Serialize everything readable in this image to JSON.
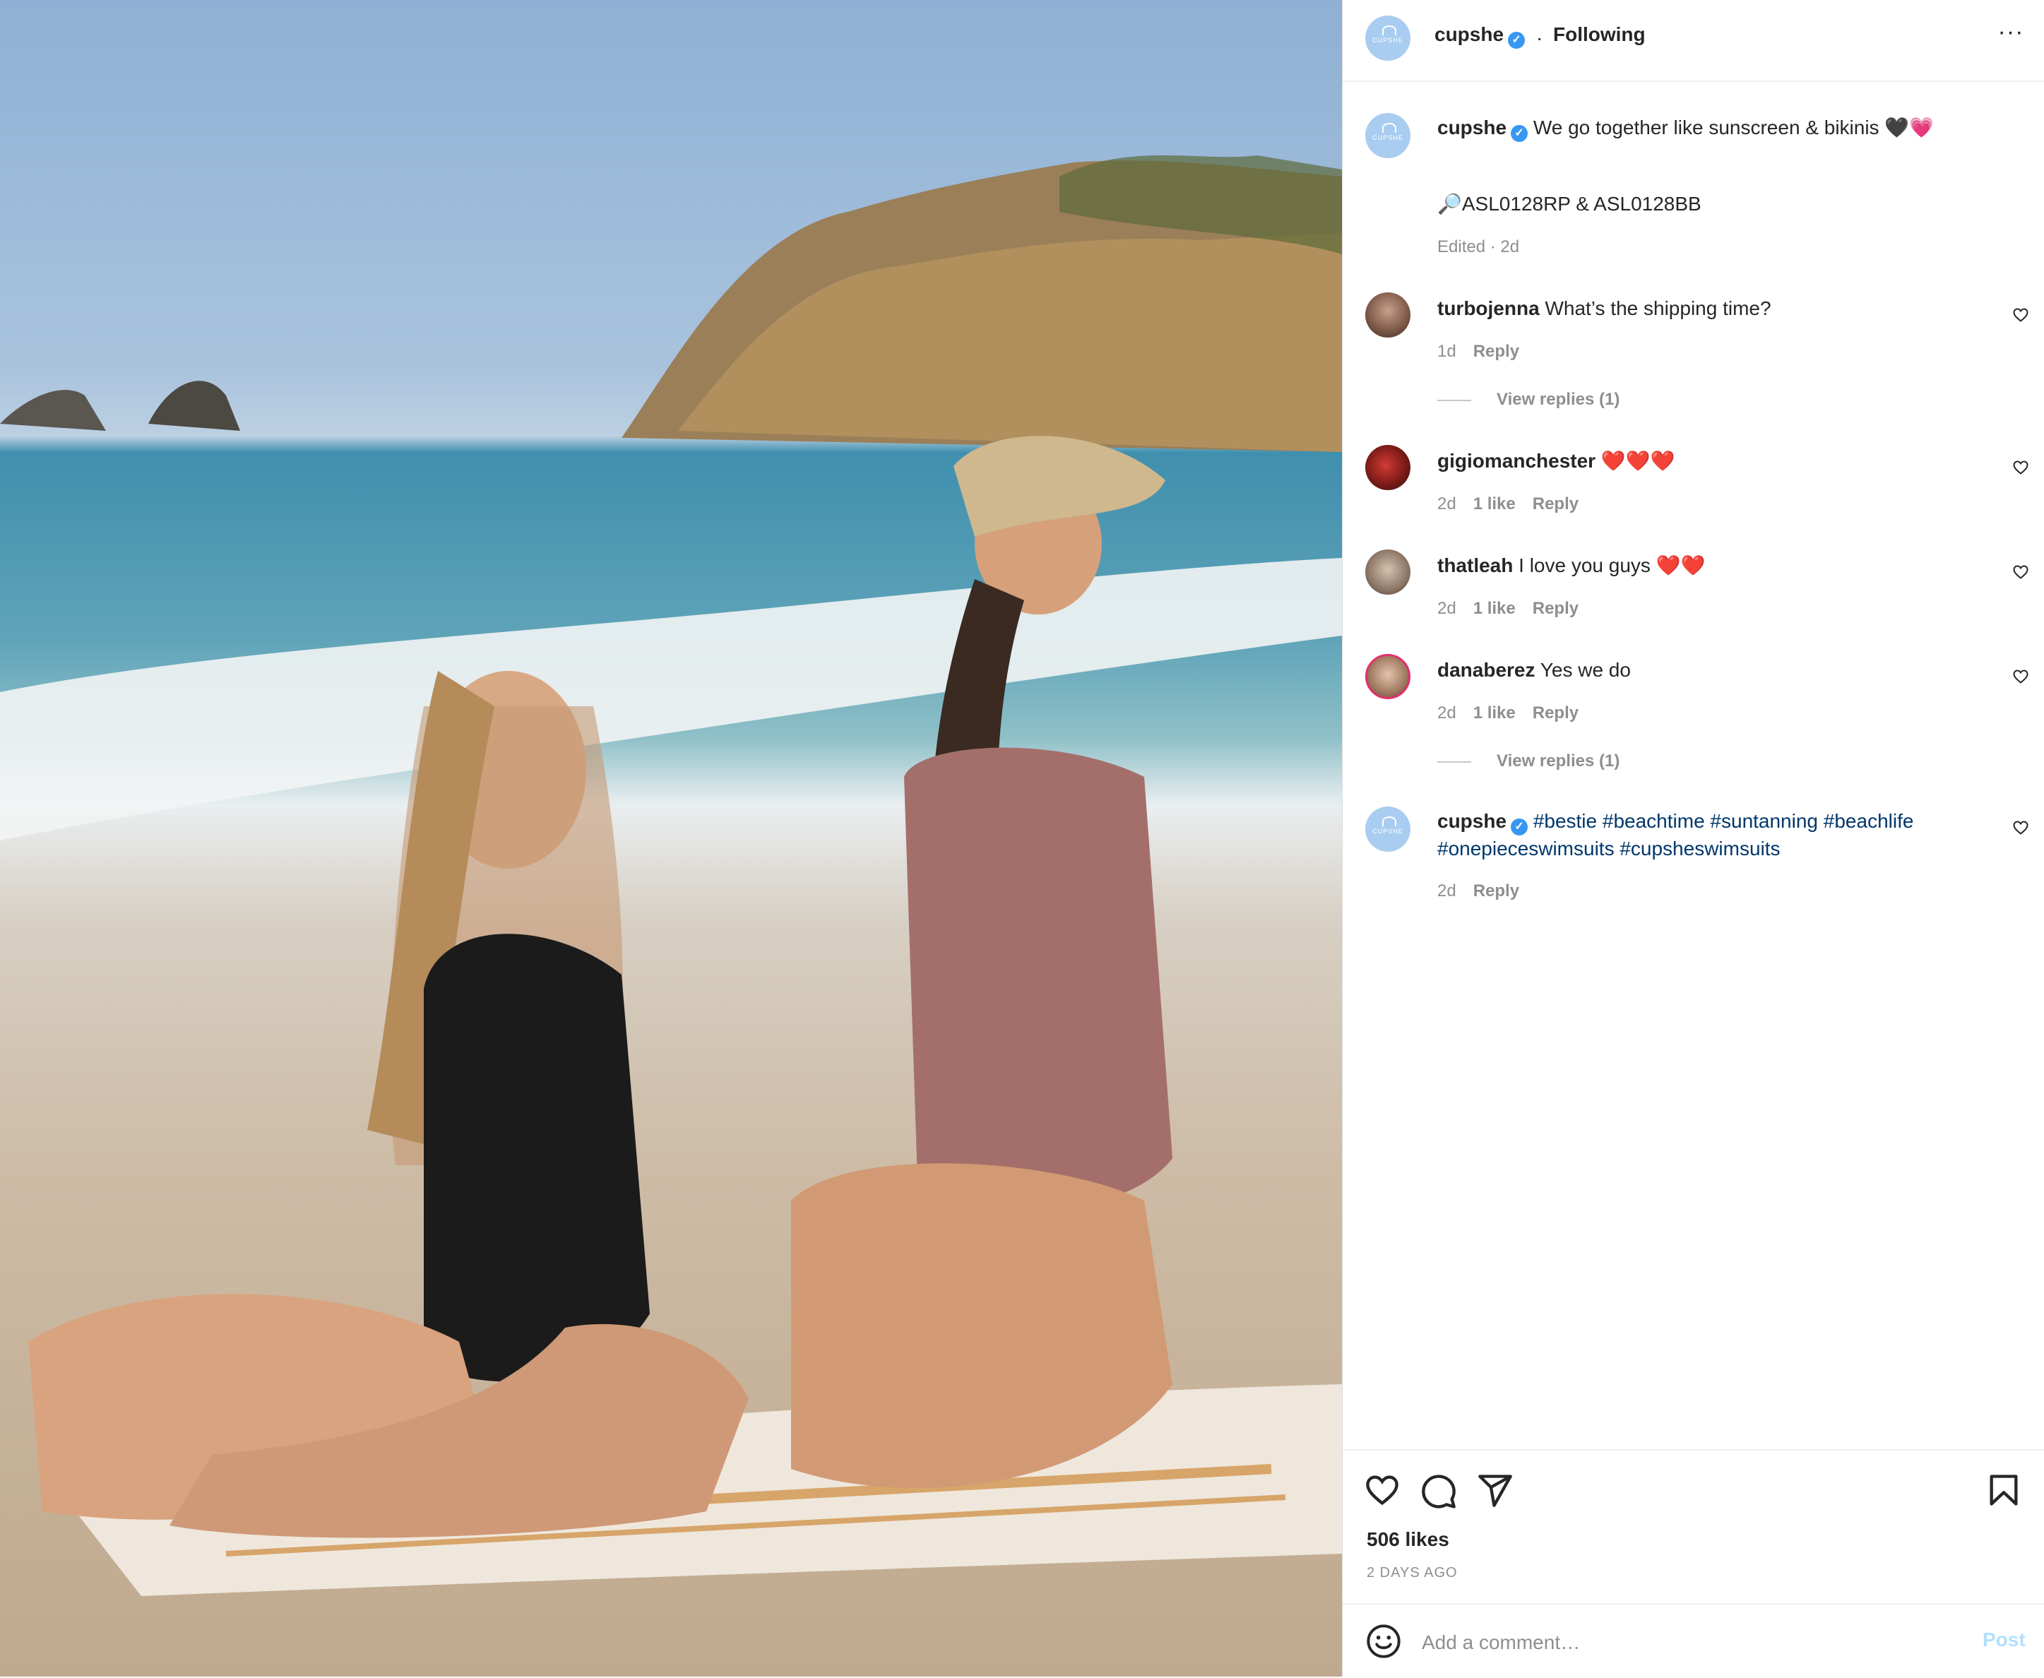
{
  "post": {
    "author": "cupshe",
    "author_verified": true,
    "follow_status": "Following",
    "image_description_icon": "photo"
  },
  "header": {
    "more_icon": "more-horizontal-icon"
  },
  "caption": {
    "username": "cupshe",
    "text": "We go together like sunscreen & bikinis 🖤💗",
    "product_codes": "🔎ASL0128RP & ASL0128BB",
    "meta": "Edited · 2d"
  },
  "comments": [
    {
      "username": "turbojenna",
      "text": "What’s the shipping time?",
      "time": "1d",
      "likes": "",
      "reply": "Reply",
      "view_replies": "View replies (1)"
    },
    {
      "username": "gigiomanchester",
      "text": "❤️❤️❤️",
      "time": "2d",
      "likes": "1 like",
      "reply": "Reply",
      "view_replies": ""
    },
    {
      "username": "thatleah",
      "text": "I love you guys ❤️❤️",
      "time": "2d",
      "likes": "1 like",
      "reply": "Reply",
      "view_replies": ""
    },
    {
      "username": "danaberez",
      "text": "Yes we do",
      "time": "2d",
      "likes": "1 like",
      "reply": "Reply",
      "view_replies": "View replies (1)"
    },
    {
      "username": "cupshe",
      "text": "#bestie #beachtime #suntanning #beachlife #onepieceswimsuits #cupsheswimsuits",
      "time": "2d",
      "likes": "",
      "reply": "Reply",
      "view_replies": ""
    }
  ],
  "actions": {
    "likes": "506 likes",
    "date": "2 DAYS AGO"
  },
  "add_comment": {
    "placeholder": "Add a comment…",
    "post_label": "Post"
  },
  "colors": {
    "link": "#00376b",
    "muted": "#8e8e8e",
    "post_disabled": "#b2dffc",
    "verified": "#3897f0"
  }
}
